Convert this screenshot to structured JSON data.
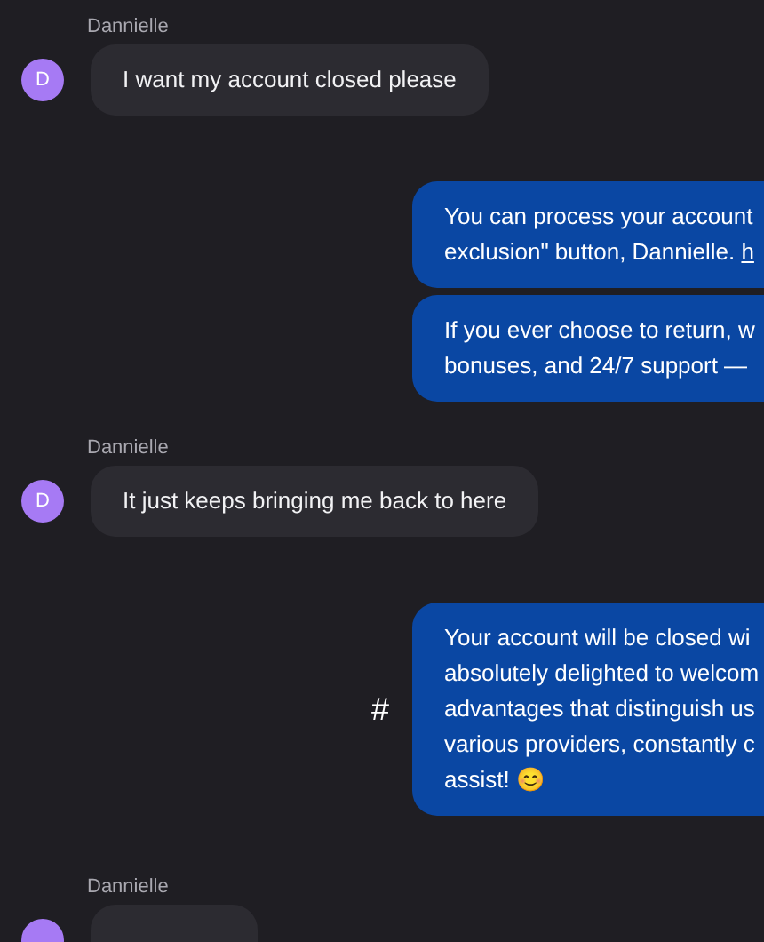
{
  "messages": [
    {
      "kind": "user",
      "sender": "Dannielle",
      "avatar": "D",
      "text": "I want my account closed please"
    },
    {
      "kind": "agent",
      "bubbles": [
        {
          "lines": [
            "You can process your account",
            "exclusion\" button, Dannielle. "
          ],
          "link": "h"
        },
        {
          "lines": [
            "If you ever choose to return, w",
            "bonuses, and 24/7 support —"
          ]
        }
      ]
    },
    {
      "kind": "user",
      "sender": "Dannielle",
      "avatar": "D",
      "text": "It just keeps bringing me back to here"
    },
    {
      "kind": "agent",
      "marker": "#",
      "bubbles": [
        {
          "lines": [
            "Your account will be closed wi",
            "absolutely delighted to welcom",
            "advantages that distinguish us",
            "various providers, constantly c",
            "assist! 😊"
          ]
        }
      ]
    },
    {
      "kind": "user",
      "sender": "Dannielle"
    }
  ]
}
